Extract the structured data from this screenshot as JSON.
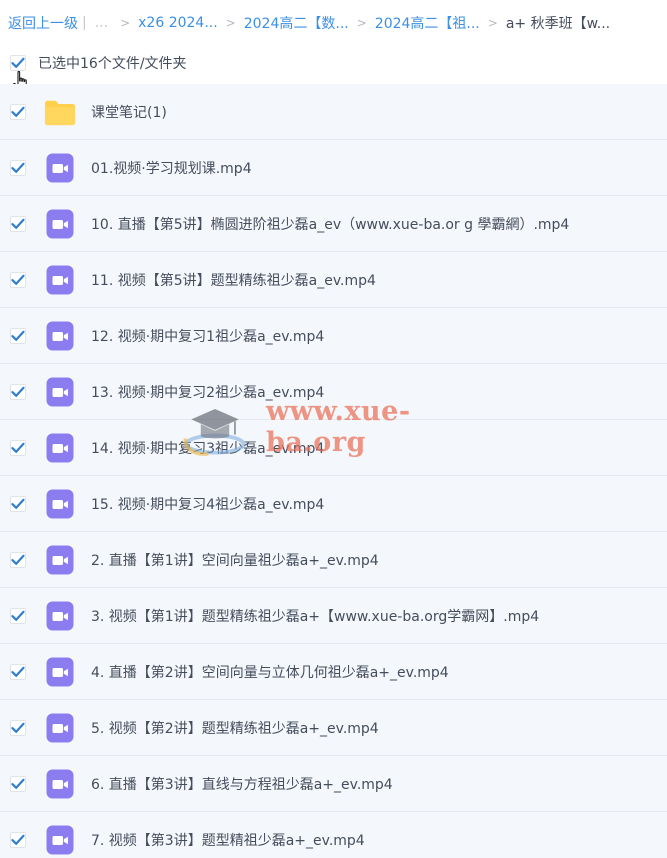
{
  "breadcrumb": {
    "back_label": "返回上一级",
    "divider": "|",
    "ellipsis": "...",
    "sep": ">",
    "items": [
      {
        "label": "x26 2024..."
      },
      {
        "label": "2024高二【数..."
      },
      {
        "label": "2024高二【祖..."
      }
    ],
    "current": "a+ 秋季班【w..."
  },
  "selection": {
    "label": "已选中16个文件/文件夹",
    "checked": true
  },
  "files": [
    {
      "name": "课堂笔记(1)",
      "type": "folder",
      "checked": true
    },
    {
      "name": "01.视频·学习规划课.mp4",
      "type": "video",
      "checked": true
    },
    {
      "name": "10. 直播【第5讲】椭圆进阶祖少磊a_ev（www.xue-ba.or g 學霸網）.mp4",
      "type": "video",
      "checked": true
    },
    {
      "name": "11. 视频【第5讲】题型精练祖少磊a_ev.mp4",
      "type": "video",
      "checked": true
    },
    {
      "name": "12. 视频·期中复习1祖少磊a_ev.mp4",
      "type": "video",
      "checked": true
    },
    {
      "name": "13. 视频·期中复习2祖少磊a_ev.mp4",
      "type": "video",
      "checked": true
    },
    {
      "name": "14. 视频·期中复习3祖少磊a_ev.mp4",
      "type": "video",
      "checked": true
    },
    {
      "name": "15. 视频·期中复习4祖少磊a_ev.mp4",
      "type": "video",
      "checked": true
    },
    {
      "name": "2. 直播【第1讲】空间向量祖少磊a+_ev.mp4",
      "type": "video",
      "checked": true
    },
    {
      "name": "3. 视频【第1讲】题型精练祖少磊a+【www.xue-ba.org学霸网】.mp4",
      "type": "video",
      "checked": true
    },
    {
      "name": "4. 直播【第2讲】空间向量与立体几何祖少磊a+_ev.mp4",
      "type": "video",
      "checked": true
    },
    {
      "name": "5. 视频【第2讲】题型精练祖少磊a+_ev.mp4",
      "type": "video",
      "checked": true
    },
    {
      "name": "6. 直播【第3讲】直线与方程祖少磊a+_ev.mp4",
      "type": "video",
      "checked": true
    },
    {
      "name": "7. 视频【第3讲】题型精祖少磊a+_ev.mp4",
      "type": "video",
      "checked": true
    }
  ],
  "watermark": {
    "text": "www.xue-ba.org"
  },
  "colors": {
    "link": "#3c8fe6",
    "check": "#2f7fd6",
    "folder": "#ffcf4d",
    "video": "#8b7df0",
    "row_bg": "#f4f7fb",
    "watermark": "#ec6e55"
  },
  "icons": {
    "checkbox": "check-icon",
    "folder": "folder-icon",
    "video": "video-file-icon",
    "cursor": "hand-pointer-icon",
    "watermark_logo": "graduation-cap-icon"
  }
}
